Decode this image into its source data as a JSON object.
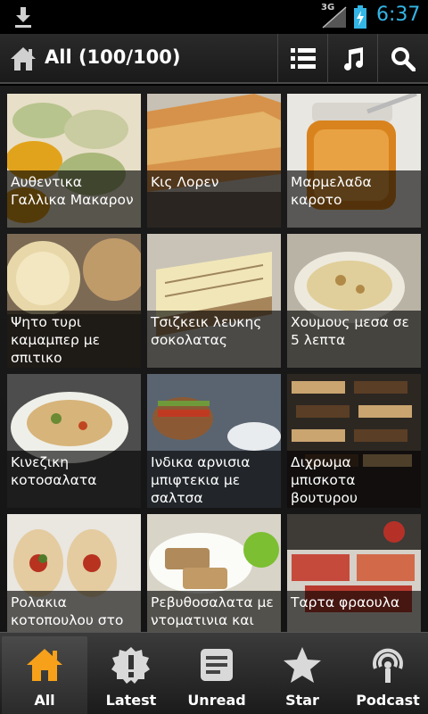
{
  "status_bar": {
    "time": "6:37",
    "network": "3G"
  },
  "action_bar": {
    "title": "All (100/100)"
  },
  "recipes": [
    {
      "title": "Αυθεντικα Γαλλικα Μακαρον"
    },
    {
      "title": "Κις Λορεν"
    },
    {
      "title": "Μαρμελαδα καροτο"
    },
    {
      "title": "Ψητο τυρι καμαμπερ με σπιτικο"
    },
    {
      "title": "Τσιζκεικ λευκης σοκολατας"
    },
    {
      "title": "Χουμους μεσα σε 5 λεπτα"
    },
    {
      "title": "Κινεζικη κοτοσαλατα"
    },
    {
      "title": "Ινδικα αρνισια μπιφτεκια με σαλτσα"
    },
    {
      "title": "Διχρωμα μπισκοτα βουτυρου"
    },
    {
      "title": "Ρολακια κοτοπουλου στο"
    },
    {
      "title": "Ρεβυθοσαλατα με ντοματινια και"
    },
    {
      "title": "Ταρτα φραουλα"
    }
  ],
  "bottom_nav": [
    {
      "label": "All"
    },
    {
      "label": "Latest"
    },
    {
      "label": "Unread"
    },
    {
      "label": "Star"
    },
    {
      "label": "Podcast"
    }
  ],
  "colors": {
    "accent": "#33b5e5",
    "active_tab": "#f7a11a"
  }
}
